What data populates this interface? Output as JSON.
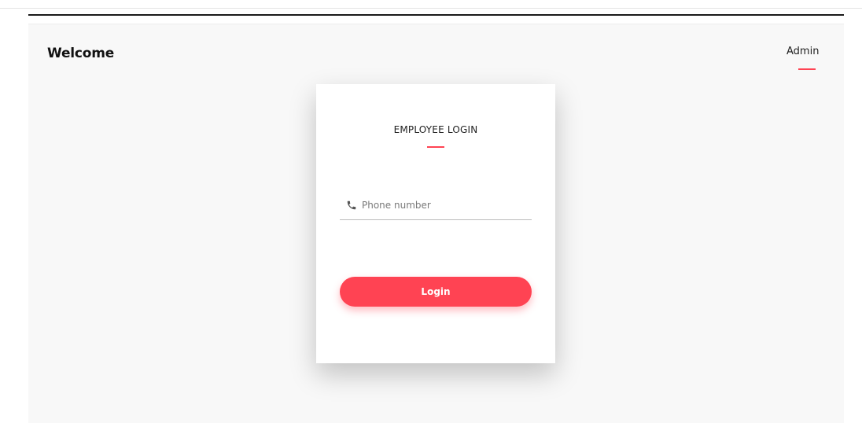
{
  "header": {
    "welcome_text": "Welcome",
    "admin_link": "Admin"
  },
  "login_card": {
    "title": "EMPLOYEE LOGIN",
    "phone_placeholder": "Phone number",
    "phone_value": "",
    "login_button": "Login",
    "phone_icon": "phone-icon"
  },
  "colors": {
    "accent": "#ff4353",
    "background": "#f8f8f8",
    "card": "#ffffff"
  }
}
